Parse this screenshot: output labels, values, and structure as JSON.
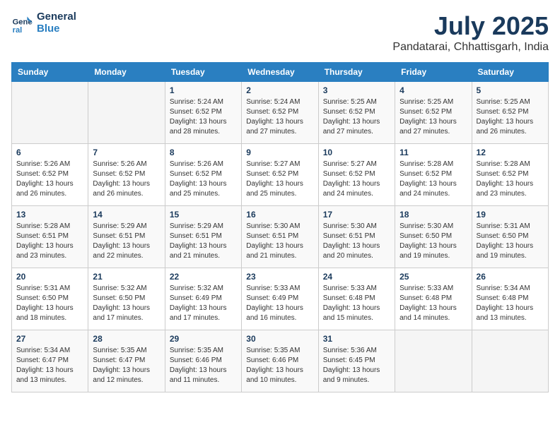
{
  "header": {
    "logo_line1": "General",
    "logo_line2": "Blue",
    "title": "July 2025",
    "subtitle": "Pandatarai, Chhattisgarh, India"
  },
  "weekdays": [
    "Sunday",
    "Monday",
    "Tuesday",
    "Wednesday",
    "Thursday",
    "Friday",
    "Saturday"
  ],
  "weeks": [
    [
      {
        "day": "",
        "sunrise": "",
        "sunset": "",
        "daylight": ""
      },
      {
        "day": "",
        "sunrise": "",
        "sunset": "",
        "daylight": ""
      },
      {
        "day": "1",
        "sunrise": "Sunrise: 5:24 AM",
        "sunset": "Sunset: 6:52 PM",
        "daylight": "Daylight: 13 hours and 28 minutes."
      },
      {
        "day": "2",
        "sunrise": "Sunrise: 5:24 AM",
        "sunset": "Sunset: 6:52 PM",
        "daylight": "Daylight: 13 hours and 27 minutes."
      },
      {
        "day": "3",
        "sunrise": "Sunrise: 5:25 AM",
        "sunset": "Sunset: 6:52 PM",
        "daylight": "Daylight: 13 hours and 27 minutes."
      },
      {
        "day": "4",
        "sunrise": "Sunrise: 5:25 AM",
        "sunset": "Sunset: 6:52 PM",
        "daylight": "Daylight: 13 hours and 27 minutes."
      },
      {
        "day": "5",
        "sunrise": "Sunrise: 5:25 AM",
        "sunset": "Sunset: 6:52 PM",
        "daylight": "Daylight: 13 hours and 26 minutes."
      }
    ],
    [
      {
        "day": "6",
        "sunrise": "Sunrise: 5:26 AM",
        "sunset": "Sunset: 6:52 PM",
        "daylight": "Daylight: 13 hours and 26 minutes."
      },
      {
        "day": "7",
        "sunrise": "Sunrise: 5:26 AM",
        "sunset": "Sunset: 6:52 PM",
        "daylight": "Daylight: 13 hours and 26 minutes."
      },
      {
        "day": "8",
        "sunrise": "Sunrise: 5:26 AM",
        "sunset": "Sunset: 6:52 PM",
        "daylight": "Daylight: 13 hours and 25 minutes."
      },
      {
        "day": "9",
        "sunrise": "Sunrise: 5:27 AM",
        "sunset": "Sunset: 6:52 PM",
        "daylight": "Daylight: 13 hours and 25 minutes."
      },
      {
        "day": "10",
        "sunrise": "Sunrise: 5:27 AM",
        "sunset": "Sunset: 6:52 PM",
        "daylight": "Daylight: 13 hours and 24 minutes."
      },
      {
        "day": "11",
        "sunrise": "Sunrise: 5:28 AM",
        "sunset": "Sunset: 6:52 PM",
        "daylight": "Daylight: 13 hours and 24 minutes."
      },
      {
        "day": "12",
        "sunrise": "Sunrise: 5:28 AM",
        "sunset": "Sunset: 6:52 PM",
        "daylight": "Daylight: 13 hours and 23 minutes."
      }
    ],
    [
      {
        "day": "13",
        "sunrise": "Sunrise: 5:28 AM",
        "sunset": "Sunset: 6:51 PM",
        "daylight": "Daylight: 13 hours and 23 minutes."
      },
      {
        "day": "14",
        "sunrise": "Sunrise: 5:29 AM",
        "sunset": "Sunset: 6:51 PM",
        "daylight": "Daylight: 13 hours and 22 minutes."
      },
      {
        "day": "15",
        "sunrise": "Sunrise: 5:29 AM",
        "sunset": "Sunset: 6:51 PM",
        "daylight": "Daylight: 13 hours and 21 minutes."
      },
      {
        "day": "16",
        "sunrise": "Sunrise: 5:30 AM",
        "sunset": "Sunset: 6:51 PM",
        "daylight": "Daylight: 13 hours and 21 minutes."
      },
      {
        "day": "17",
        "sunrise": "Sunrise: 5:30 AM",
        "sunset": "Sunset: 6:51 PM",
        "daylight": "Daylight: 13 hours and 20 minutes."
      },
      {
        "day": "18",
        "sunrise": "Sunrise: 5:30 AM",
        "sunset": "Sunset: 6:50 PM",
        "daylight": "Daylight: 13 hours and 19 minutes."
      },
      {
        "day": "19",
        "sunrise": "Sunrise: 5:31 AM",
        "sunset": "Sunset: 6:50 PM",
        "daylight": "Daylight: 13 hours and 19 minutes."
      }
    ],
    [
      {
        "day": "20",
        "sunrise": "Sunrise: 5:31 AM",
        "sunset": "Sunset: 6:50 PM",
        "daylight": "Daylight: 13 hours and 18 minutes."
      },
      {
        "day": "21",
        "sunrise": "Sunrise: 5:32 AM",
        "sunset": "Sunset: 6:50 PM",
        "daylight": "Daylight: 13 hours and 17 minutes."
      },
      {
        "day": "22",
        "sunrise": "Sunrise: 5:32 AM",
        "sunset": "Sunset: 6:49 PM",
        "daylight": "Daylight: 13 hours and 17 minutes."
      },
      {
        "day": "23",
        "sunrise": "Sunrise: 5:33 AM",
        "sunset": "Sunset: 6:49 PM",
        "daylight": "Daylight: 13 hours and 16 minutes."
      },
      {
        "day": "24",
        "sunrise": "Sunrise: 5:33 AM",
        "sunset": "Sunset: 6:48 PM",
        "daylight": "Daylight: 13 hours and 15 minutes."
      },
      {
        "day": "25",
        "sunrise": "Sunrise: 5:33 AM",
        "sunset": "Sunset: 6:48 PM",
        "daylight": "Daylight: 13 hours and 14 minutes."
      },
      {
        "day": "26",
        "sunrise": "Sunrise: 5:34 AM",
        "sunset": "Sunset: 6:48 PM",
        "daylight": "Daylight: 13 hours and 13 minutes."
      }
    ],
    [
      {
        "day": "27",
        "sunrise": "Sunrise: 5:34 AM",
        "sunset": "Sunset: 6:47 PM",
        "daylight": "Daylight: 13 hours and 13 minutes."
      },
      {
        "day": "28",
        "sunrise": "Sunrise: 5:35 AM",
        "sunset": "Sunset: 6:47 PM",
        "daylight": "Daylight: 13 hours and 12 minutes."
      },
      {
        "day": "29",
        "sunrise": "Sunrise: 5:35 AM",
        "sunset": "Sunset: 6:46 PM",
        "daylight": "Daylight: 13 hours and 11 minutes."
      },
      {
        "day": "30",
        "sunrise": "Sunrise: 5:35 AM",
        "sunset": "Sunset: 6:46 PM",
        "daylight": "Daylight: 13 hours and 10 minutes."
      },
      {
        "day": "31",
        "sunrise": "Sunrise: 5:36 AM",
        "sunset": "Sunset: 6:45 PM",
        "daylight": "Daylight: 13 hours and 9 minutes."
      },
      {
        "day": "",
        "sunrise": "",
        "sunset": "",
        "daylight": ""
      },
      {
        "day": "",
        "sunrise": "",
        "sunset": "",
        "daylight": ""
      }
    ]
  ]
}
